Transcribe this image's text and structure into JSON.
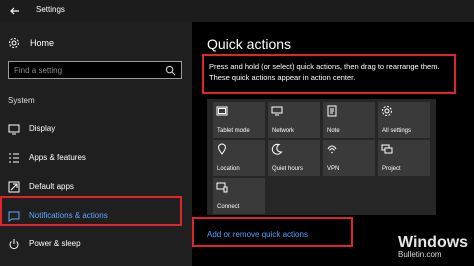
{
  "window": {
    "title": "Settings"
  },
  "sidebar": {
    "home_label": "Home",
    "search_placeholder": "Find a setting",
    "section_label": "System",
    "items": [
      {
        "label": "Display",
        "icon": "monitor-icon"
      },
      {
        "label": "Apps & features",
        "icon": "list-icon"
      },
      {
        "label": "Default apps",
        "icon": "default-apps-icon"
      },
      {
        "label": "Notifications & actions",
        "icon": "message-icon",
        "active": true
      },
      {
        "label": "Power & sleep",
        "icon": "power-icon"
      }
    ]
  },
  "main": {
    "heading": "Quick actions",
    "description": "Press and hold (or select) quick actions, then drag to rearrange them. These quick actions appear in action center.",
    "tiles": [
      {
        "label": "Tablet mode",
        "icon": "tablet-icon"
      },
      {
        "label": "Network",
        "icon": "network-icon"
      },
      {
        "label": "Note",
        "icon": "note-icon"
      },
      {
        "label": "All settings",
        "icon": "gear-icon"
      },
      {
        "label": "Location",
        "icon": "location-icon"
      },
      {
        "label": "Quiet hours",
        "icon": "moon-icon"
      },
      {
        "label": "VPN",
        "icon": "vpn-icon"
      },
      {
        "label": "Project",
        "icon": "project-icon"
      },
      {
        "label": "Connect",
        "icon": "connect-icon"
      }
    ],
    "link_label": "Add or remove quick actions"
  },
  "watermark": {
    "line1": "Windows",
    "line2": "Bulletin.com"
  },
  "colors": {
    "accent": "#4da3ff",
    "highlight": "#e0242b",
    "tile": "#3a3a3a",
    "panel": "#262626"
  }
}
